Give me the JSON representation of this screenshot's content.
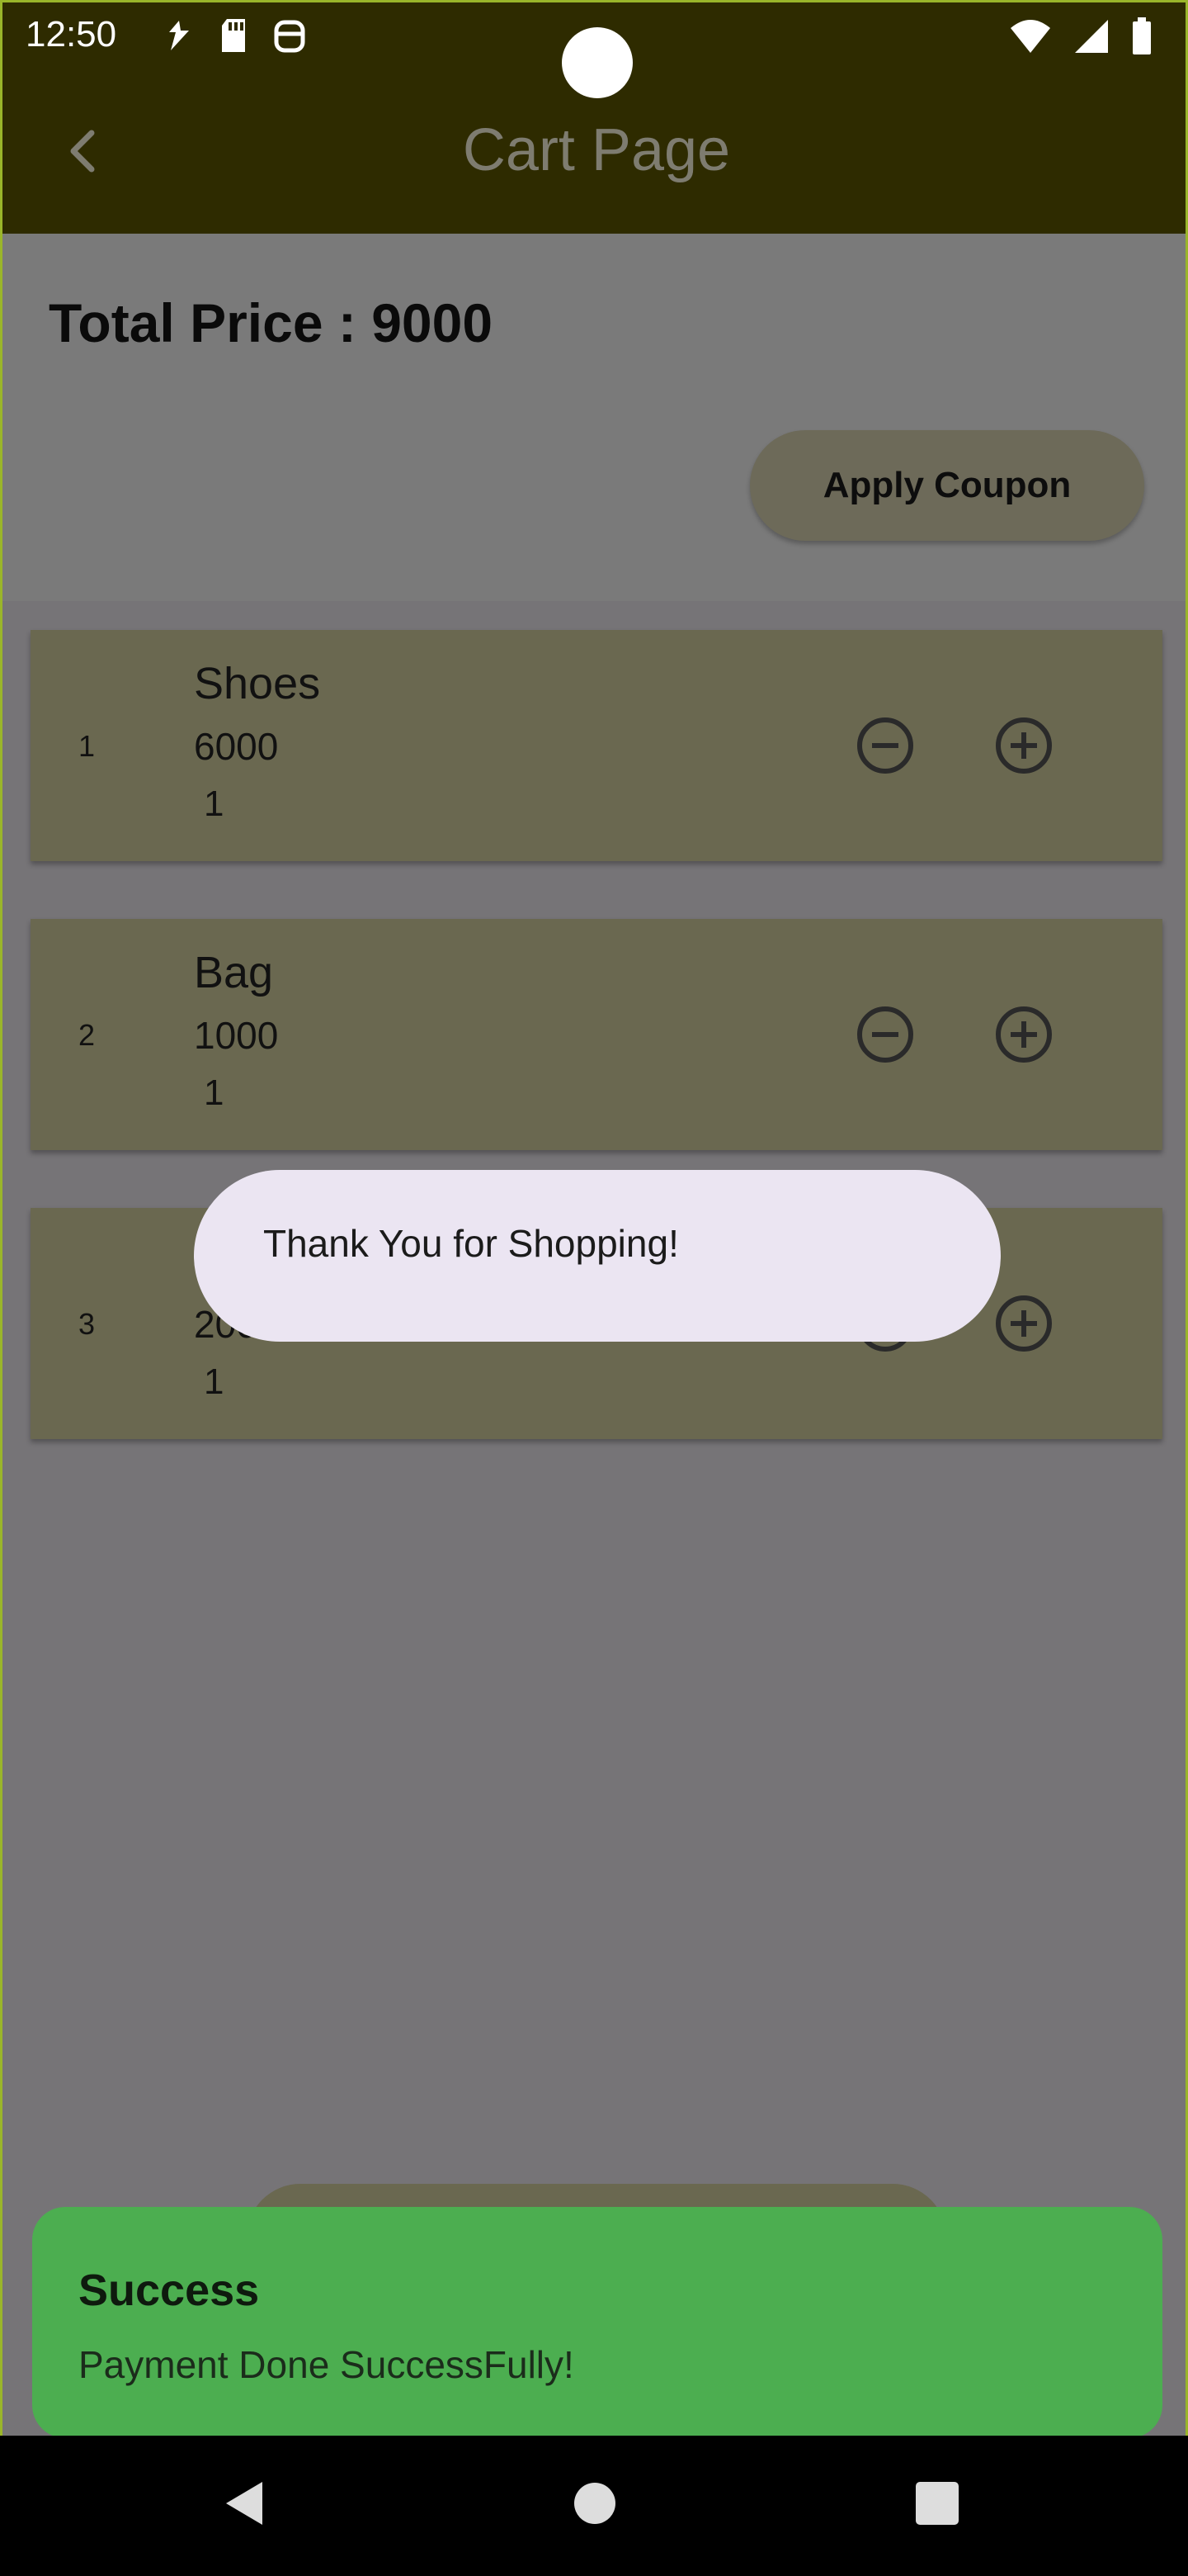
{
  "status_bar": {
    "time": "12:50",
    "left_icons": [
      "navigation-arrow-icon",
      "sd-card-icon",
      "face-icon"
    ],
    "right_icons": [
      "wifi-icon",
      "cell-signal-icon",
      "battery-icon"
    ]
  },
  "appbar": {
    "title": "Cart Page",
    "back_icon": "chevron-left-icon",
    "background": "#2e2b00"
  },
  "summary": {
    "total_price": "Total Price : 9000",
    "coupon_label": "Apply Coupon"
  },
  "cart": {
    "items": [
      {
        "index": "1",
        "name": "Shoes",
        "price": "6000",
        "qty": "1"
      },
      {
        "index": "2",
        "name": "Bag",
        "price": "1000",
        "qty": "1"
      },
      {
        "index": "3",
        "name": "",
        "price": "2000",
        "qty": "1"
      }
    ],
    "minus_icon": "minus-circle-icon",
    "plus_icon": "plus-circle-icon"
  },
  "toast": {
    "message": "Thank You for Shopping!"
  },
  "snackbar": {
    "title": "Success",
    "message": "Payment Done SuccessFully!",
    "color": "#4cae50"
  },
  "navbar": {
    "icons": [
      "back-triangle-icon",
      "home-circle-icon",
      "recents-square-icon"
    ]
  }
}
